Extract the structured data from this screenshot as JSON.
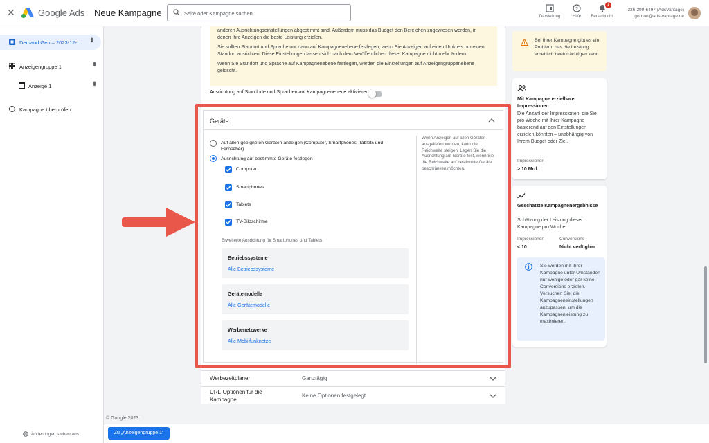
{
  "header": {
    "brand": "Google Ads",
    "page_title": "Neue Kampagne",
    "search_placeholder": "Seite oder Kampagne suchen",
    "tools": [
      {
        "label": "Darstellung",
        "icon": "appearance-icon"
      },
      {
        "label": "Hilfe",
        "icon": "help-icon"
      },
      {
        "label": "Benachricht.",
        "icon": "bell-icon",
        "badge": "1"
      }
    ],
    "account_id": "336-299-6497 (AdsVantage)",
    "account_email": "gordon@ads-vantage.de"
  },
  "sidebar": {
    "items": [
      {
        "label": "Demand Gen – 2023-12-…",
        "icon": "campaign-icon",
        "active": true
      },
      {
        "label": "Anzeigengruppe 1",
        "icon": "grid-icon"
      },
      {
        "label": "Anzeige 1",
        "icon": "ad-icon"
      },
      {
        "label": "Kampagne überprüfen",
        "icon": "info-icon"
      }
    ],
    "changes_status": "Änderungen stehen aus"
  },
  "main": {
    "notice": [
      "anderen Ausrichtungseinstellungen abgestimmt sind. Außerdem muss das Budget den Bereichen zugewiesen werden, in denen Ihre Anzeigen die beste Leistung erzielen.",
      "Sie sollten Standort und Sprache nur dann auf Kampagnenebene festlegen, wenn Sie Anzeigen auf einen Umkreis um einen Standort ausrichten. Diese Einstellungen lassen sich nach dem Veröffentlichen dieser Kampagne nicht mehr ändern.",
      "Wenn Sie Standort und Sprache auf Kampagnenebene festlegen, werden die Einstellungen auf Anzeigengruppenebene gelöscht."
    ],
    "toggle_label": "Ausrichtung auf Standorte und Sprachen auf Kampagnenebene aktivieren",
    "devices": {
      "title": "Geräte",
      "option_all": "Auf allen geeigneten Geräten anzeigen (Computer, Smartphones, Tablets und Fernseher)",
      "option_specific": "Ausrichtung auf bestimmte Geräte festlegen",
      "selected_option": "specific",
      "checkboxes": [
        "Computer",
        "Smartphones",
        "Tablets",
        "TV-Bildschirme"
      ],
      "hint": "Wenn Anzeigen auf allen Geräten ausgeliefert werden, kann die Reichweite steigen. Legen Sie die Ausrichtung auf Geräte fest, wenn Sie die Reichweite auf bestimmte Geräte beschränken möchten.",
      "extended_label": "Erweiterte Ausrichtung für Smartphones und Tablets",
      "cards": [
        {
          "title": "Betriebssysteme",
          "link": "Alle Betriebssysteme"
        },
        {
          "title": "Gerätemodelle",
          "link": "Alle Gerätemodelle"
        },
        {
          "title": "Werbenetzwerke",
          "link": "Alle Mobilfunknetze"
        }
      ]
    },
    "accordions": [
      {
        "label": "Werbezeitplaner",
        "value": "Ganztägig"
      },
      {
        "label": "URL-Optionen für die Kampagne",
        "value": "Keine Optionen festgelegt"
      }
    ]
  },
  "right_panel": {
    "warning": "Bei Ihrer Kampagne gibt es ein Problem, das die Leistung erheblich beeinträchtigen kann",
    "impressions_card": {
      "title": "Mit Kampagne erzielbare Impressionen",
      "desc": "Die Anzahl der Impressionen, die Sie pro Woche mit Ihrer Kampagne basierend auf den Einstellungen erzielen könnten – unabhängig von Ihrem Budget oder Ziel.",
      "stat_label": "Impressionen",
      "stat_value": "> 10 Mrd."
    },
    "results_card": {
      "title": "Geschätzte Kampagnenergebnisse",
      "desc": "Schätzung der Leistung dieser Kampagne pro Woche",
      "impr_label": "Impressionen",
      "impr_value": "< 10",
      "conv_label": "Conversions",
      "conv_value": "Nicht verfügbar",
      "info": "Sie werden mit Ihrer Kampagne unter Umständen nur wenige oder gar keine Conversions erzielen. Versuchen Sie, die Kampagneneinstellungen anzupassen, um die Kampagnenleistung zu maximieren."
    }
  },
  "footer": {
    "copyright": "© Google 2023.",
    "next_button": "Zu „Anzeigengruppe 1“"
  },
  "colors": {
    "accent": "#1a73e8",
    "highlight": "#e8574a",
    "warning_bg": "#fef7e0"
  }
}
